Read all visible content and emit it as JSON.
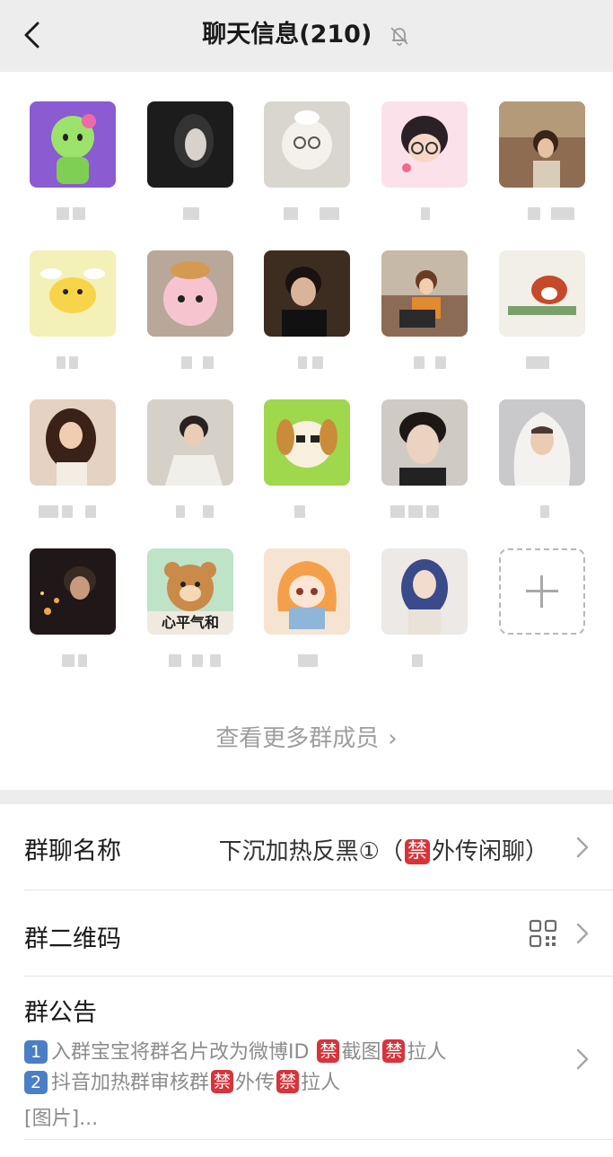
{
  "header": {
    "title": "聊天信息(210)",
    "back_icon": "chevron-left-icon",
    "mute_icon": "bell-off-icon"
  },
  "members": [
    {
      "avatar_icon": "hello-kitty-avatar"
    },
    {
      "avatar_icon": "dark-hair-girl-avatar"
    },
    {
      "avatar_icon": "plush-dog-avatar"
    },
    {
      "avatar_icon": "anime-glasses-girl-avatar"
    },
    {
      "avatar_icon": "girl-portrait-avatar"
    },
    {
      "avatar_icon": "angel-chick-avatar"
    },
    {
      "avatar_icon": "pink-plush-avatar"
    },
    {
      "avatar_icon": "boy-portrait-avatar"
    },
    {
      "avatar_icon": "cartoon-girl-laptop-avatar"
    },
    {
      "avatar_icon": "red-panda-avatar"
    },
    {
      "avatar_icon": "long-hair-girl-avatar"
    },
    {
      "avatar_icon": "boy-white-shirt-avatar"
    },
    {
      "avatar_icon": "cartoon-dog-avatar"
    },
    {
      "avatar_icon": "boy-closeup-avatar"
    },
    {
      "avatar_icon": "hooded-boy-avatar"
    },
    {
      "avatar_icon": "night-portrait-avatar"
    },
    {
      "avatar_icon": "bear-sticker-avatar",
      "caption": "心平气和"
    },
    {
      "avatar_icon": "umaru-avatar"
    },
    {
      "avatar_icon": "blue-hair-girl-avatar"
    }
  ],
  "add_member": {
    "icon": "plus-icon"
  },
  "more_members": {
    "label": "查看更多群成员"
  },
  "group_name": {
    "label": "群聊名称",
    "value_prefix": "下沉加热反黑①（",
    "ban": "禁",
    "value_suffix": "外传闲聊）"
  },
  "qr_code": {
    "label": "群二维码",
    "icon": "qr-code-icon"
  },
  "notice": {
    "label": "群公告",
    "line1": {
      "num": "1",
      "text_a": "入群宝宝将群名片改为微博ID ",
      "ban1": "禁",
      "text_b": "截图",
      "ban2": "禁",
      "text_c": "拉人"
    },
    "line2": {
      "num": "2",
      "text_a": "抖音加热群审核群",
      "ban1": "禁",
      "text_b": "外传",
      "ban2": "禁",
      "text_c": "拉人"
    },
    "line3": "[图片]..."
  },
  "colors": {
    "header_bg": "#ededed",
    "ban_red": "#d6343a",
    "num_blue": "#4a7fc6",
    "muted_text": "#9e9e9e"
  }
}
